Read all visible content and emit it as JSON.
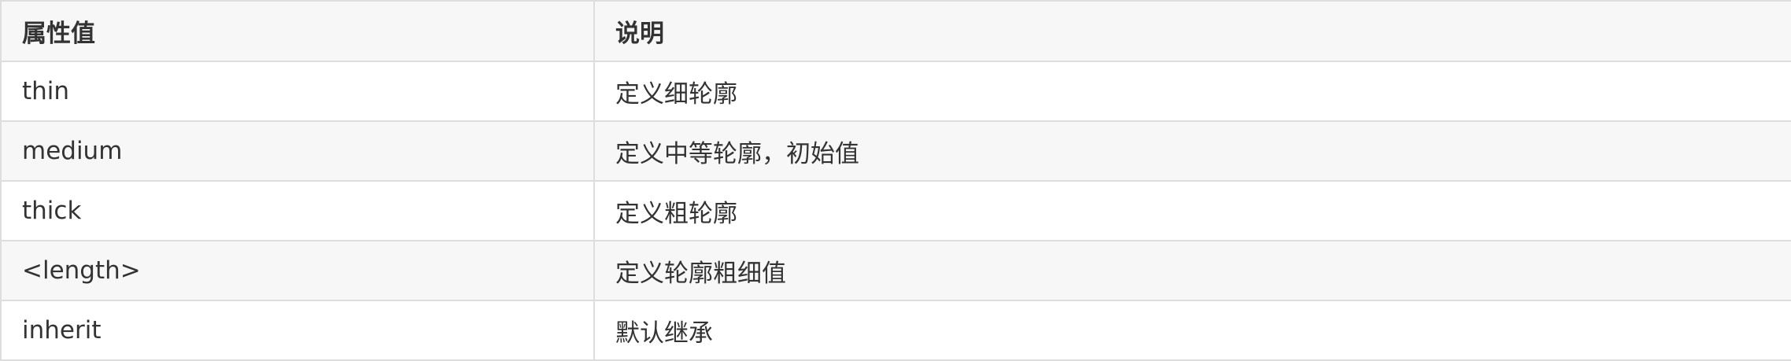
{
  "table": {
    "headers": [
      "属性值",
      "说明"
    ],
    "rows": [
      [
        "thin",
        "定义细轮廓"
      ],
      [
        "medium",
        "定义中等轮廓，初始值"
      ],
      [
        "thick",
        "定义粗轮廓"
      ],
      [
        "<length>",
        "定义轮廓粗细值"
      ],
      [
        "inherit",
        "默认继承"
      ]
    ]
  }
}
